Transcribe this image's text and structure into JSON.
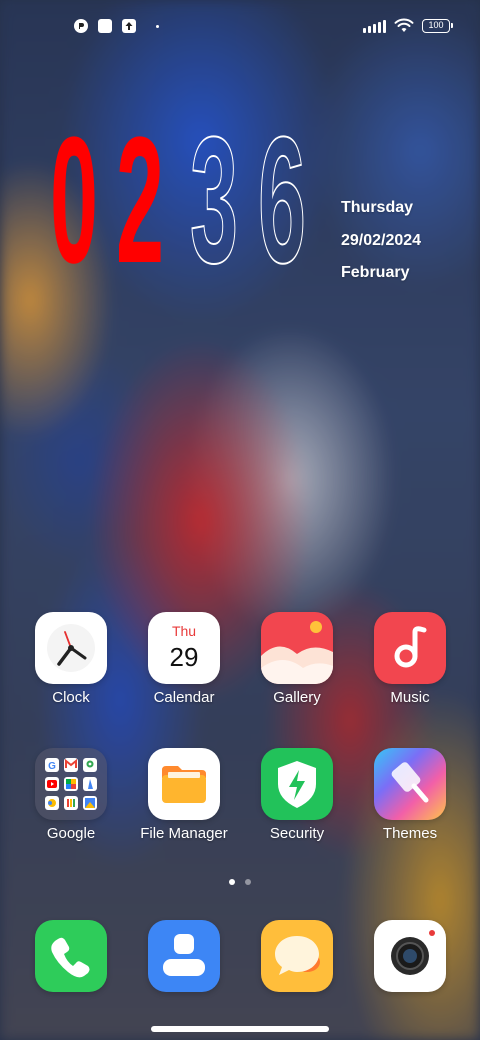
{
  "status_bar": {
    "left_icons": [
      "app-notification-icon",
      "square-notification-icon",
      "upload-notification-icon",
      "more-notifications-dot"
    ],
    "right_icons": [
      "cellular-signal-icon",
      "wifi-icon",
      "battery-icon"
    ],
    "battery_level": "100"
  },
  "clock": {
    "hour_digits": [
      "0",
      "2"
    ],
    "minute_digits": [
      "3",
      "6"
    ],
    "hour_color": "#ff0000",
    "minute_outline_color": "#ffffff",
    "weekday": "Thursday",
    "date": "29/02/2024",
    "month": "February"
  },
  "apps": [
    {
      "label": "Clock",
      "icon": "clock-app-icon"
    },
    {
      "label": "Calendar",
      "icon": "calendar-app-icon",
      "badge_day": "Thu",
      "badge_date": "29"
    },
    {
      "label": "Gallery",
      "icon": "gallery-app-icon"
    },
    {
      "label": "Music",
      "icon": "music-app-icon"
    },
    {
      "label": "Google",
      "icon": "google-folder-icon"
    },
    {
      "label": "File Manager",
      "icon": "file-manager-app-icon"
    },
    {
      "label": "Security",
      "icon": "security-app-icon"
    },
    {
      "label": "Themes",
      "icon": "themes-app-icon"
    }
  ],
  "pages": {
    "count": 2,
    "current": 1
  },
  "dock": [
    {
      "icon": "phone-app-icon",
      "color": "#2ecc5a"
    },
    {
      "icon": "contacts-app-icon",
      "color": "#3d86f5"
    },
    {
      "icon": "messages-app-icon",
      "color": "#ffbe3b"
    },
    {
      "icon": "camera-app-icon",
      "color": "#ffffff"
    }
  ],
  "colors": {
    "music": "#f2464f",
    "security": "#22c25a",
    "gallery": "#f2464f",
    "file_manager_folder": "#ffb52e"
  }
}
